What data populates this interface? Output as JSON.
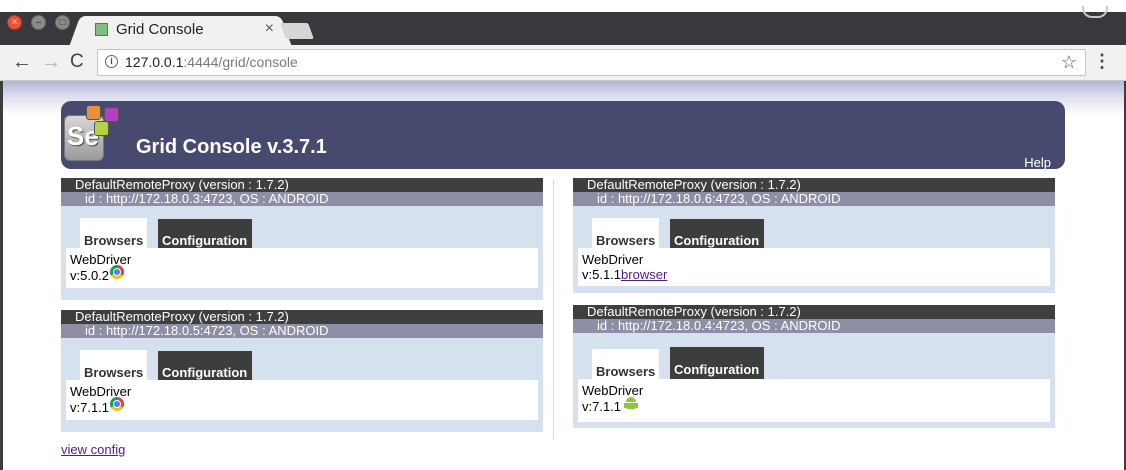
{
  "browser": {
    "tab_title": "Grid Console",
    "tab_close": "×",
    "url_host": "127.0.0.1",
    "url_rest": ":4444/grid/console",
    "info_glyph": "i",
    "star_glyph": "☆",
    "menu_glyph": "⋮",
    "back_glyph": "←",
    "forward_glyph": "→",
    "reload_glyph": "C",
    "close_glyph": "×",
    "min_glyph": "–",
    "max_glyph": "□"
  },
  "header": {
    "logo_text": "Se",
    "title": "Grid Console v.3.7.1",
    "help": "Help"
  },
  "proxies": [
    {
      "title": "DefaultRemoteProxy (version : 1.7.2)",
      "id_line": "id : http://172.18.0.3:4723, OS : ANDROID",
      "tab_browsers": "Browsers",
      "tab_configuration": "Configuration",
      "driver": "WebDriver",
      "version": "v:5.0.2",
      "icon": "chrome-icon"
    },
    {
      "title": "DefaultRemoteProxy (version : 1.7.2)",
      "id_line": "id : http://172.18.0.5:4723, OS : ANDROID",
      "tab_browsers": "Browsers",
      "tab_configuration": "Configuration",
      "driver": "WebDriver",
      "version": "v:7.1.1",
      "icon": "chrome-icon"
    },
    {
      "title": "DefaultRemoteProxy (version : 1.7.2)",
      "id_line": "id : http://172.18.0.6:4723, OS : ANDROID",
      "tab_browsers": "Browsers",
      "tab_configuration": "Configuration",
      "driver": "WebDriver",
      "version": "v:5.1.1",
      "browser_link": "browser"
    },
    {
      "title": "DefaultRemoteProxy (version : 1.7.2)",
      "id_line": "id : http://172.18.0.4:4723, OS : ANDROID",
      "tab_browsers": "Browsers",
      "tab_configuration": "Configuration",
      "driver": "WebDriver",
      "version": "v:7.1.1",
      "icon": "android-icon"
    }
  ],
  "footer": {
    "view_config": "view config"
  }
}
